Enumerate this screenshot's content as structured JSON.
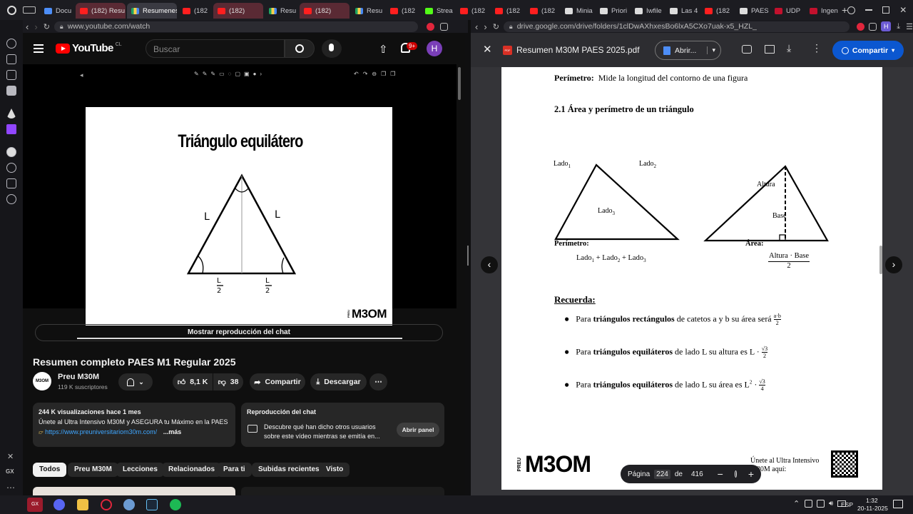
{
  "tabs": [
    {
      "label": "Docu",
      "fav": "doc"
    },
    {
      "label": "(182) Resu",
      "fav": "yt",
      "state": "hl"
    },
    {
      "label": "Resumenes",
      "fav": "gd",
      "state": "active"
    },
    {
      "label": "(182",
      "fav": "yt"
    },
    {
      "label": "(182)",
      "fav": "yt",
      "state": "hl"
    },
    {
      "label": "Resu",
      "fav": "gd"
    },
    {
      "label": "(182)",
      "fav": "yt",
      "state": "hl"
    },
    {
      "label": "Resu",
      "fav": "gd"
    },
    {
      "label": "(182",
      "fav": "yt"
    },
    {
      "label": "Strea",
      "fav": "kick"
    },
    {
      "label": "(182",
      "fav": "yt"
    },
    {
      "label": "(182",
      "fav": "yt"
    },
    {
      "label": "(182",
      "fav": "yt"
    },
    {
      "label": "Minia",
      "fav": "wh"
    },
    {
      "label": "Priori",
      "fav": "wh"
    },
    {
      "label": "Iwfile",
      "fav": "wh"
    },
    {
      "label": "Las 4",
      "fav": "wh"
    },
    {
      "label": "(182",
      "fav": "yt"
    },
    {
      "label": "PAES",
      "fav": "wh"
    },
    {
      "label": "UDP",
      "fav": "udp"
    },
    {
      "label": "Ingen",
      "fav": "udp"
    }
  ],
  "youtube": {
    "url": "www.youtube.com/watch",
    "logo": "YouTube",
    "region": "CL",
    "search_placeholder": "Buscar",
    "notif_count": "9+",
    "avatar": "H",
    "slide": {
      "title": "Triángulo equilátero",
      "brand": "M3OM",
      "brand_prefix": "PREU"
    },
    "chat_replay_button": "Mostrar reproducción del chat",
    "video_title": "Resumen completo PAES M1 Regular 2025",
    "channel": {
      "name": "Preu M30M",
      "subs": "119 K suscriptores",
      "logo": "M3OM"
    },
    "likes": "8,1 K",
    "dislikes": "38",
    "share": "Compartir",
    "download": "Descargar",
    "description": {
      "meta": "244 K visualizaciones  hace 1 mes",
      "line1": "Únete al Ultra Intensivo M30M y ASEGURA tu Máximo en la PAES",
      "link": "https://www.preuniversitariom30m.com/",
      "more": "...más"
    },
    "chat": {
      "title": "Reproducción del chat",
      "text": "Descubre qué han dicho otros usuarios sobre este vídeo mientras se emitía en...",
      "button": "Abrir panel"
    },
    "chips": [
      "Todos",
      "Preu M30M",
      "Lecciones",
      "Relacionados",
      "Para ti",
      "Subidas recientes",
      "Visto"
    ]
  },
  "drive": {
    "url": "drive.google.com/drive/folders/1clDwAXhxesBo6lxA5CXo7uak-x5_HZL_",
    "file_name": "Resumen M30M PAES 2025.pdf",
    "open_button": "Abrir...",
    "share_button": "Compartir",
    "doc": {
      "perimetro_label": "Perímetro:",
      "perimetro_def": "Mide la longitud del contorno de una figura",
      "section": "2.1 Área y perímetro de un triángulo",
      "lado": "Lado",
      "altura": "Altura",
      "base": "Base",
      "per_title": "Perímetro:",
      "area_title": "Área:",
      "area_num": "Altura · Base",
      "area_den": "2",
      "recuerda": "Recuerda:",
      "para": "Para",
      "b1_bold": "triángulos rectángulos",
      "b1_rest": "de catetos a y b su área será",
      "b2_bold": "triángulos equiláteros",
      "b2_rest": "de lado L su altura es L ·",
      "b3_bold": "triángulos equiláteros",
      "b3_rest": "de lado L su área es L",
      "footer_prefix": "PREU",
      "footer_brand": "M3OM",
      "footer_text1": "Únete al Ultra Intensivo",
      "footer_text2": "M30M aquí:"
    },
    "pager": {
      "label": "Página",
      "current": "224",
      "of": "de",
      "total": "416"
    }
  },
  "taskbar": {
    "lang": "ESP",
    "time": "1:32",
    "date": "20-11-2025"
  }
}
